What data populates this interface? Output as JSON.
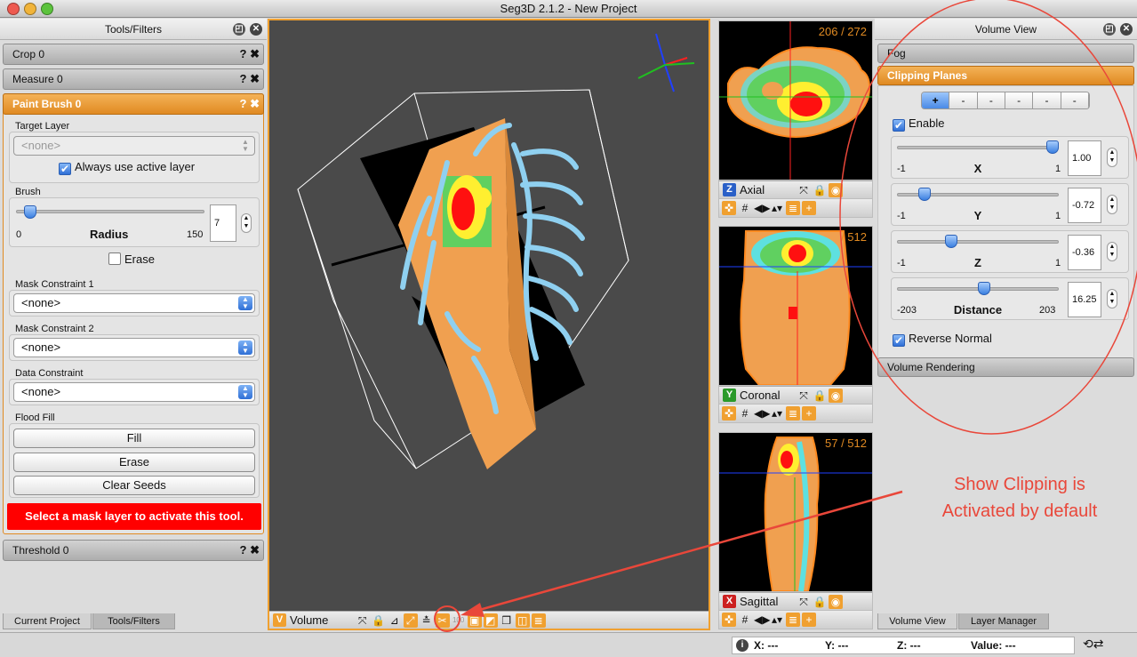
{
  "window": {
    "title": "Seg3D 2.1.2  - New Project"
  },
  "tools_panel": {
    "title": "Tools/Filters",
    "crop": "Crop 0",
    "measure": "Measure 0",
    "paint_brush": "Paint Brush 0",
    "target_layer_label": "Target Layer",
    "target_layer_value": "<none>",
    "always_use_active_label": "Always use active layer",
    "brush_label": "Brush",
    "radius_label": "Radius",
    "radius_min": "0",
    "radius_max": "150",
    "radius_value": "7",
    "radius_fraction": 0.047,
    "erase_check_label": "Erase",
    "mask1_label": "Mask Constraint 1",
    "mask1_value": "<none>",
    "mask2_label": "Mask Constraint 2",
    "mask2_value": "<none>",
    "data_label": "Data Constraint",
    "data_value": "<none>",
    "flood_label": "Flood Fill",
    "fill_button": "Fill",
    "erase_button": "Erase",
    "clear_seeds_button": "Clear Seeds",
    "warning": "Select a mask layer to activate this tool.",
    "threshold": "Threshold 0",
    "help_glyph": "?",
    "close_glyph": "✖",
    "tab_current_project": "Current Project",
    "tab_tools_filters": "Tools/Filters"
  },
  "viewers": {
    "volume_badge": "V",
    "volume_label": "Volume",
    "axial_badge": "Z",
    "axial_label": "Axial",
    "axial_slice": "206 / 272",
    "coronal_badge": "Y",
    "coronal_label": "Coronal",
    "coronal_slice": "/ 512",
    "sagittal_badge": "X",
    "sagittal_label": "Sagittal",
    "sagittal_slice": "57 / 512"
  },
  "volume_view": {
    "title": "Volume View",
    "fog": "Fog",
    "clipping_planes": "Clipping Planes",
    "plane_tabs": [
      "+",
      "-",
      "-",
      "-",
      "-",
      "-"
    ],
    "enable_label": "Enable",
    "x": {
      "label": "X",
      "min": "-1",
      "max": "1",
      "value": "1.00",
      "fraction": 1.0
    },
    "y": {
      "label": "Y",
      "min": "-1",
      "max": "1",
      "value": "-0.72",
      "fraction": 0.14
    },
    "z": {
      "label": "Z",
      "min": "-1",
      "max": "1",
      "value": "-0.36",
      "fraction": 0.32
    },
    "distance": {
      "label": "Distance",
      "min": "-203",
      "max": "203",
      "value": "16.25",
      "fraction": 0.54
    },
    "reverse_normal_label": "Reverse Normal",
    "volume_rendering": "Volume Rendering",
    "tab_volume_view": "Volume View",
    "tab_layer_manager": "Layer Manager"
  },
  "annotation": {
    "line1": "Show Clipping is",
    "line2": "Activated by default"
  },
  "status_bar": {
    "x": "X: ---",
    "y": "Y: ---",
    "z": "Z: ---",
    "value": "Value: ---"
  },
  "colors": {
    "accent": "#e08a22",
    "warning": "#ff0000",
    "annotation": "#e9473a"
  }
}
